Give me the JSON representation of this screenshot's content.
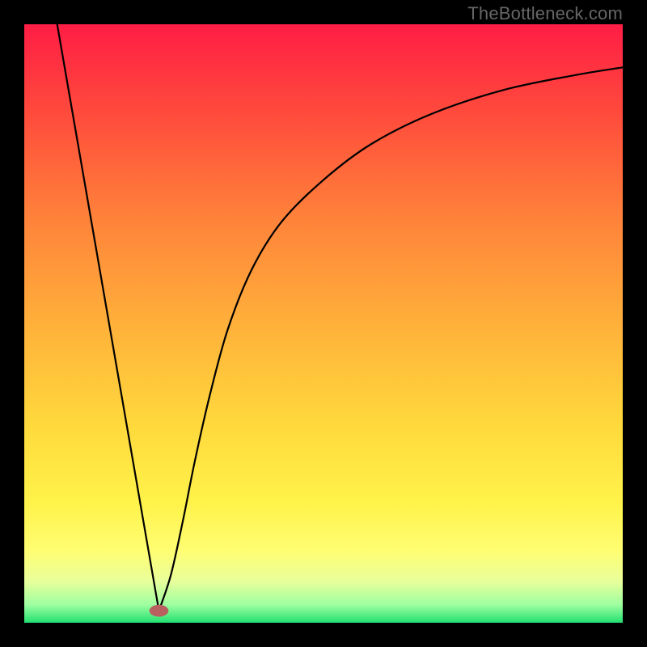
{
  "watermark": "TheBottleneck.com",
  "chart_data": {
    "type": "line",
    "title": "",
    "xlabel": "",
    "ylabel": "",
    "xlim": [
      0,
      1
    ],
    "ylim": [
      0,
      1
    ],
    "gradient_bands": [
      {
        "color": "#ff1d45",
        "stop": 0.0
      },
      {
        "color": "#ff4b3c",
        "stop": 0.15
      },
      {
        "color": "#ff813a",
        "stop": 0.32
      },
      {
        "color": "#ffb03a",
        "stop": 0.5
      },
      {
        "color": "#ffd93c",
        "stop": 0.67
      },
      {
        "color": "#fff34a",
        "stop": 0.8
      },
      {
        "color": "#fffd72",
        "stop": 0.88
      },
      {
        "color": "#e9ff9b",
        "stop": 0.93
      },
      {
        "color": "#9effa0",
        "stop": 0.97
      },
      {
        "color": "#22e070",
        "stop": 1.0
      }
    ],
    "vertex": {
      "x": 0.225,
      "y": 0.02
    },
    "marker": {
      "x": 0.225,
      "y": 0.02,
      "rx": 0.016,
      "ry": 0.01,
      "color": "#b86060"
    },
    "series": [
      {
        "name": "left-branch",
        "x": [
          0.055,
          0.225
        ],
        "y": [
          1.0,
          0.02
        ]
      },
      {
        "name": "right-branch",
        "x": [
          0.225,
          0.245,
          0.265,
          0.285,
          0.31,
          0.34,
          0.38,
          0.43,
          0.5,
          0.58,
          0.68,
          0.8,
          0.92,
          1.0
        ],
        "y": [
          0.02,
          0.08,
          0.17,
          0.27,
          0.38,
          0.49,
          0.59,
          0.67,
          0.74,
          0.8,
          0.85,
          0.89,
          0.915,
          0.928
        ]
      }
    ]
  }
}
